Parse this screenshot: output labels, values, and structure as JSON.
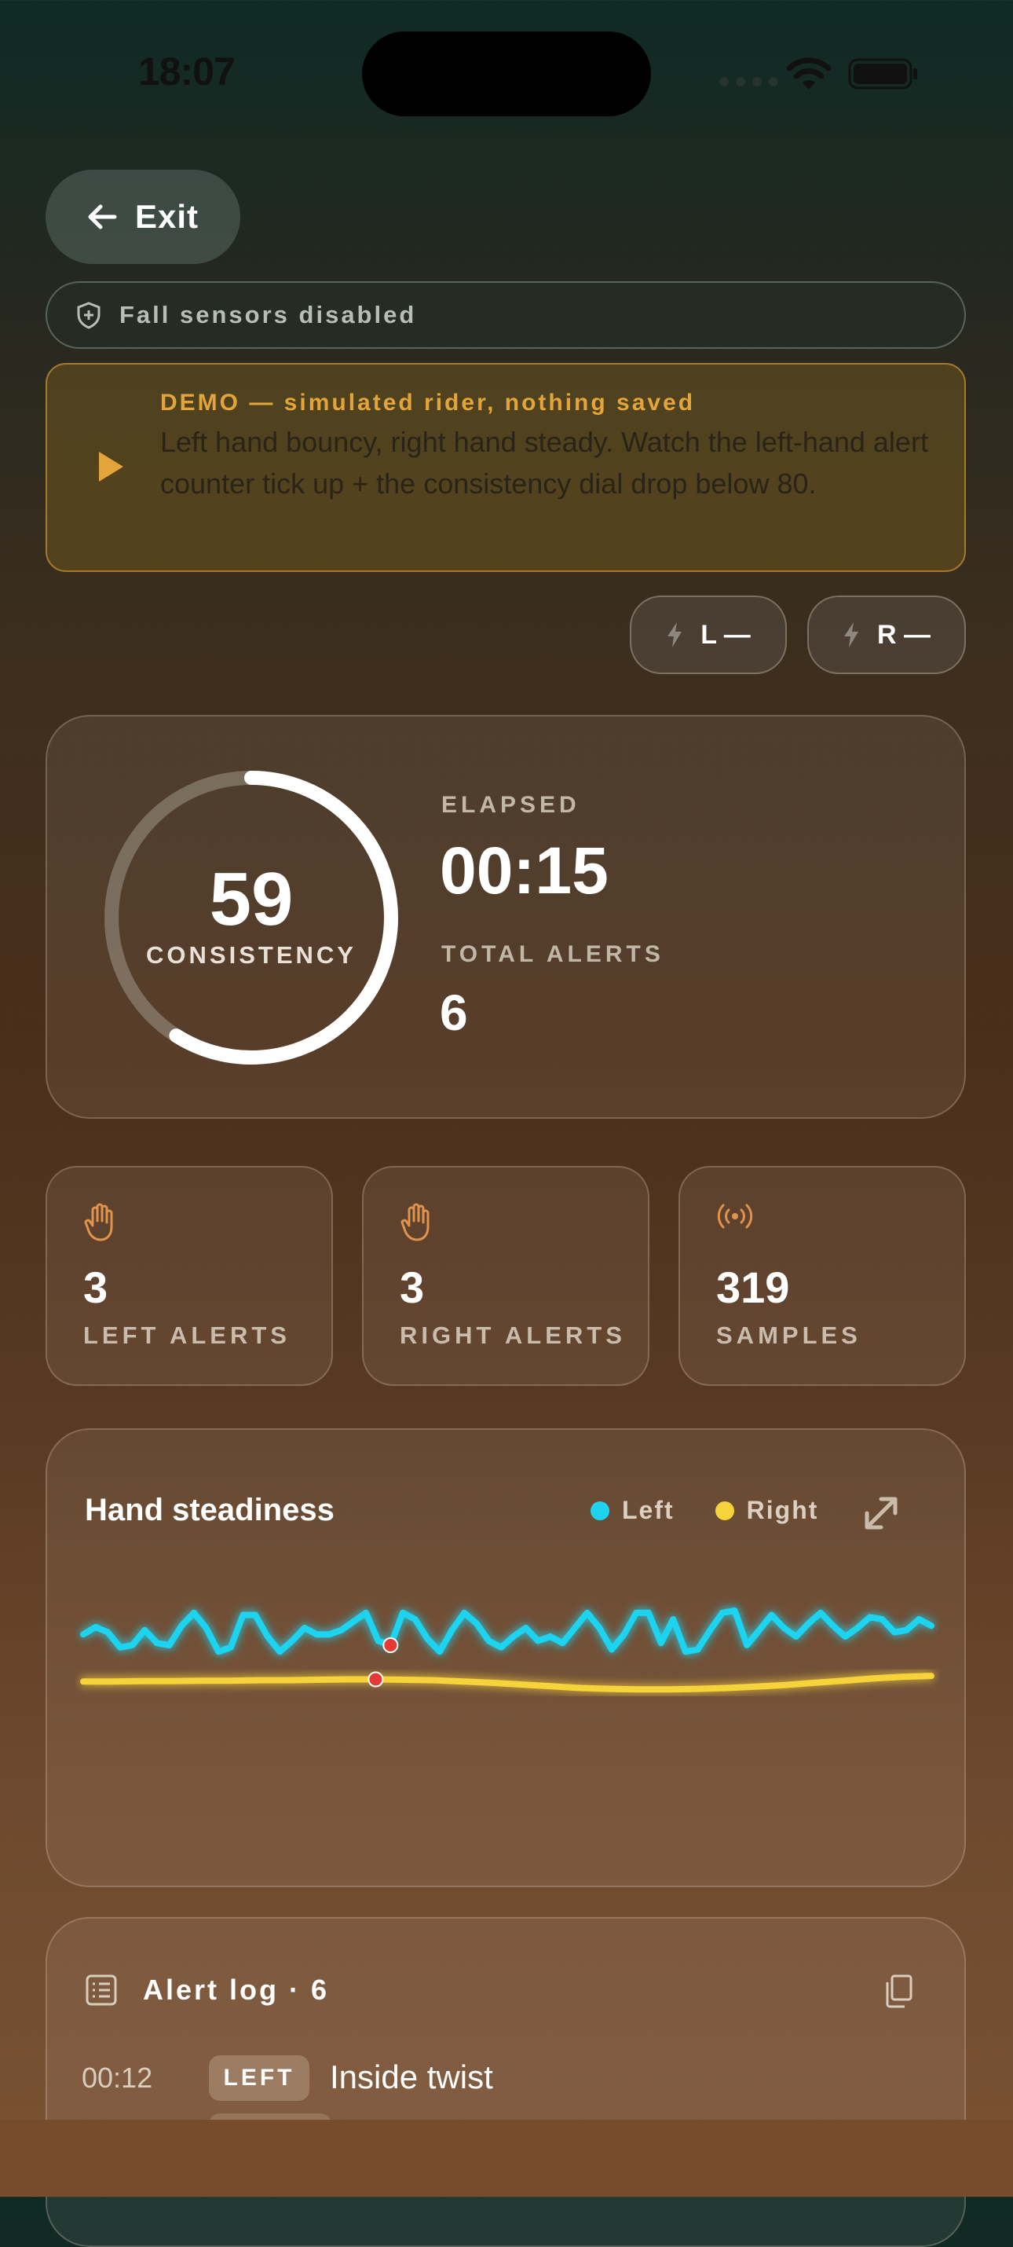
{
  "status_bar": {
    "time": "18:07"
  },
  "header": {
    "exit_label": "Exit"
  },
  "sensor_banner": {
    "text": "Fall sensors disabled"
  },
  "demo_banner": {
    "title": "DEMO — simulated rider, nothing saved",
    "body": "Left hand bouncy, right hand steady. Watch the left-hand alert counter tick up + the consistency dial drop below 80."
  },
  "hand_pills": {
    "left": "L —",
    "right": "R —"
  },
  "summary": {
    "consistency_value": "59",
    "consistency_label": "CONSISTENCY",
    "consistency_fraction": 0.59,
    "elapsed_label": "ELAPSED",
    "elapsed_value": "00:15",
    "total_alerts_label": "TOTAL ALERTS",
    "total_alerts_value": "6"
  },
  "stats": [
    {
      "value": "3",
      "label": "LEFT ALERTS",
      "icon": "hand-icon"
    },
    {
      "value": "3",
      "label": "RIGHT ALERTS",
      "icon": "hand-icon"
    },
    {
      "value": "319",
      "label": "SAMPLES",
      "icon": "broadcast-icon"
    }
  ],
  "chart": {
    "title": "Hand steadiness",
    "legend_left": "Left",
    "legend_right": "Right",
    "colors": {
      "left": "#1fd3f0",
      "right": "#f6d33a",
      "marker": "#e53935"
    }
  },
  "chart_data": {
    "type": "line",
    "title": "Hand steadiness",
    "series": [
      {
        "name": "Left",
        "values": [
          0.45,
          0.62,
          0.5,
          0.15,
          0.2,
          0.55,
          0.25,
          0.2,
          0.65,
          0.95,
          0.6,
          0.05,
          0.15,
          0.9,
          0.9,
          0.4,
          0.05,
          0.3,
          0.6,
          0.45,
          0.45,
          0.55,
          0.75,
          0.95,
          0.3,
          0.2,
          0.95,
          0.8,
          0.35,
          0.05,
          0.55,
          0.95,
          0.7,
          0.3,
          0.15,
          0.4,
          0.6,
          0.3,
          0.4,
          0.25,
          0.6,
          0.95,
          0.6,
          0.1,
          0.45,
          0.95,
          0.95,
          0.25,
          0.8,
          0.05,
          0.1,
          0.55,
          0.95,
          1.0,
          0.2,
          0.55,
          0.9,
          0.6,
          0.4,
          0.7,
          0.95,
          0.65,
          0.4,
          0.6,
          0.85,
          0.8,
          0.5,
          0.55,
          0.8,
          0.65
        ]
      },
      {
        "name": "Right",
        "values": [
          0.45,
          0.45,
          0.46,
          0.46,
          0.47,
          0.47,
          0.48,
          0.48,
          0.49,
          0.5,
          0.5,
          0.49,
          0.48,
          0.45,
          0.42,
          0.38,
          0.34,
          0.3,
          0.28,
          0.27,
          0.27,
          0.28,
          0.3,
          0.33,
          0.37,
          0.42,
          0.47,
          0.52,
          0.56,
          0.58
        ]
      }
    ],
    "markers": [
      {
        "series": "Left",
        "index": 25
      },
      {
        "series": "Right",
        "index": 10
      }
    ]
  },
  "alert_log": {
    "title": "Alert log · 6",
    "entries": [
      {
        "time": "00:12",
        "hand": "LEFT",
        "text": "Inside twist"
      }
    ]
  }
}
